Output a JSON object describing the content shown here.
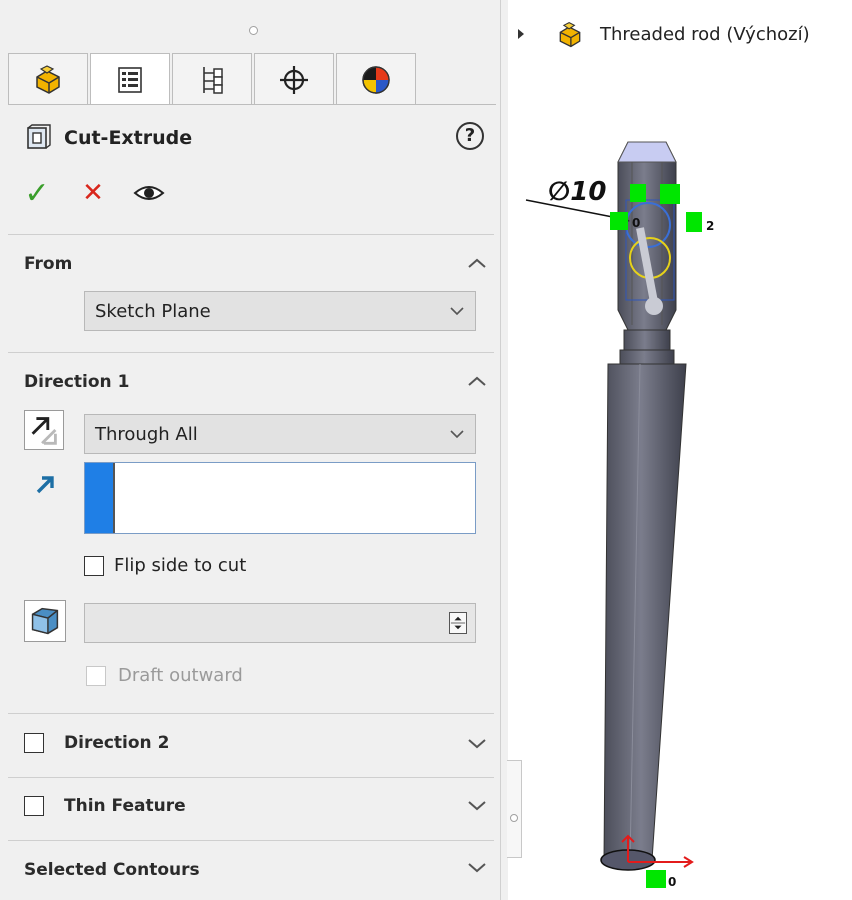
{
  "panel": {
    "tabs": [
      {
        "name": "feature-manager-tab",
        "icon": "part-icon",
        "active": false
      },
      {
        "name": "property-manager-tab",
        "icon": "property-list-icon",
        "active": true
      },
      {
        "name": "configuration-manager-tab",
        "icon": "configuration-icon",
        "active": false
      },
      {
        "name": "dimxpert-manager-tab",
        "icon": "crosshair-icon",
        "active": false
      },
      {
        "name": "display-manager-tab",
        "icon": "color-ball-icon",
        "active": false
      }
    ],
    "title": "Cut-Extrude",
    "help": "?",
    "actions": {
      "ok": "✓",
      "cancel": "✕",
      "preview": "eye-icon"
    }
  },
  "from": {
    "title": "From",
    "value": "Sketch Plane"
  },
  "direction1": {
    "title": "Direction 1",
    "end_condition": "Through All",
    "flip_label": "Flip side to cut",
    "draft_label": "Draft outward"
  },
  "direction2": {
    "title": "Direction 2"
  },
  "thin": {
    "title": "Thin Feature"
  },
  "contours": {
    "title": "Selected Contours"
  },
  "tree": {
    "label": "Threaded rod  (Výchozí)"
  },
  "viewport": {
    "dimension": "∅10",
    "relation_1": "0",
    "relation_2": "2",
    "origin_label": "0"
  },
  "colors": {
    "accent": "#1f7fe6",
    "ok_green": "#3a9e2b",
    "cancel_red": "#d9261c",
    "relation_green": "#00e600",
    "part_gray": "#6e7080"
  }
}
